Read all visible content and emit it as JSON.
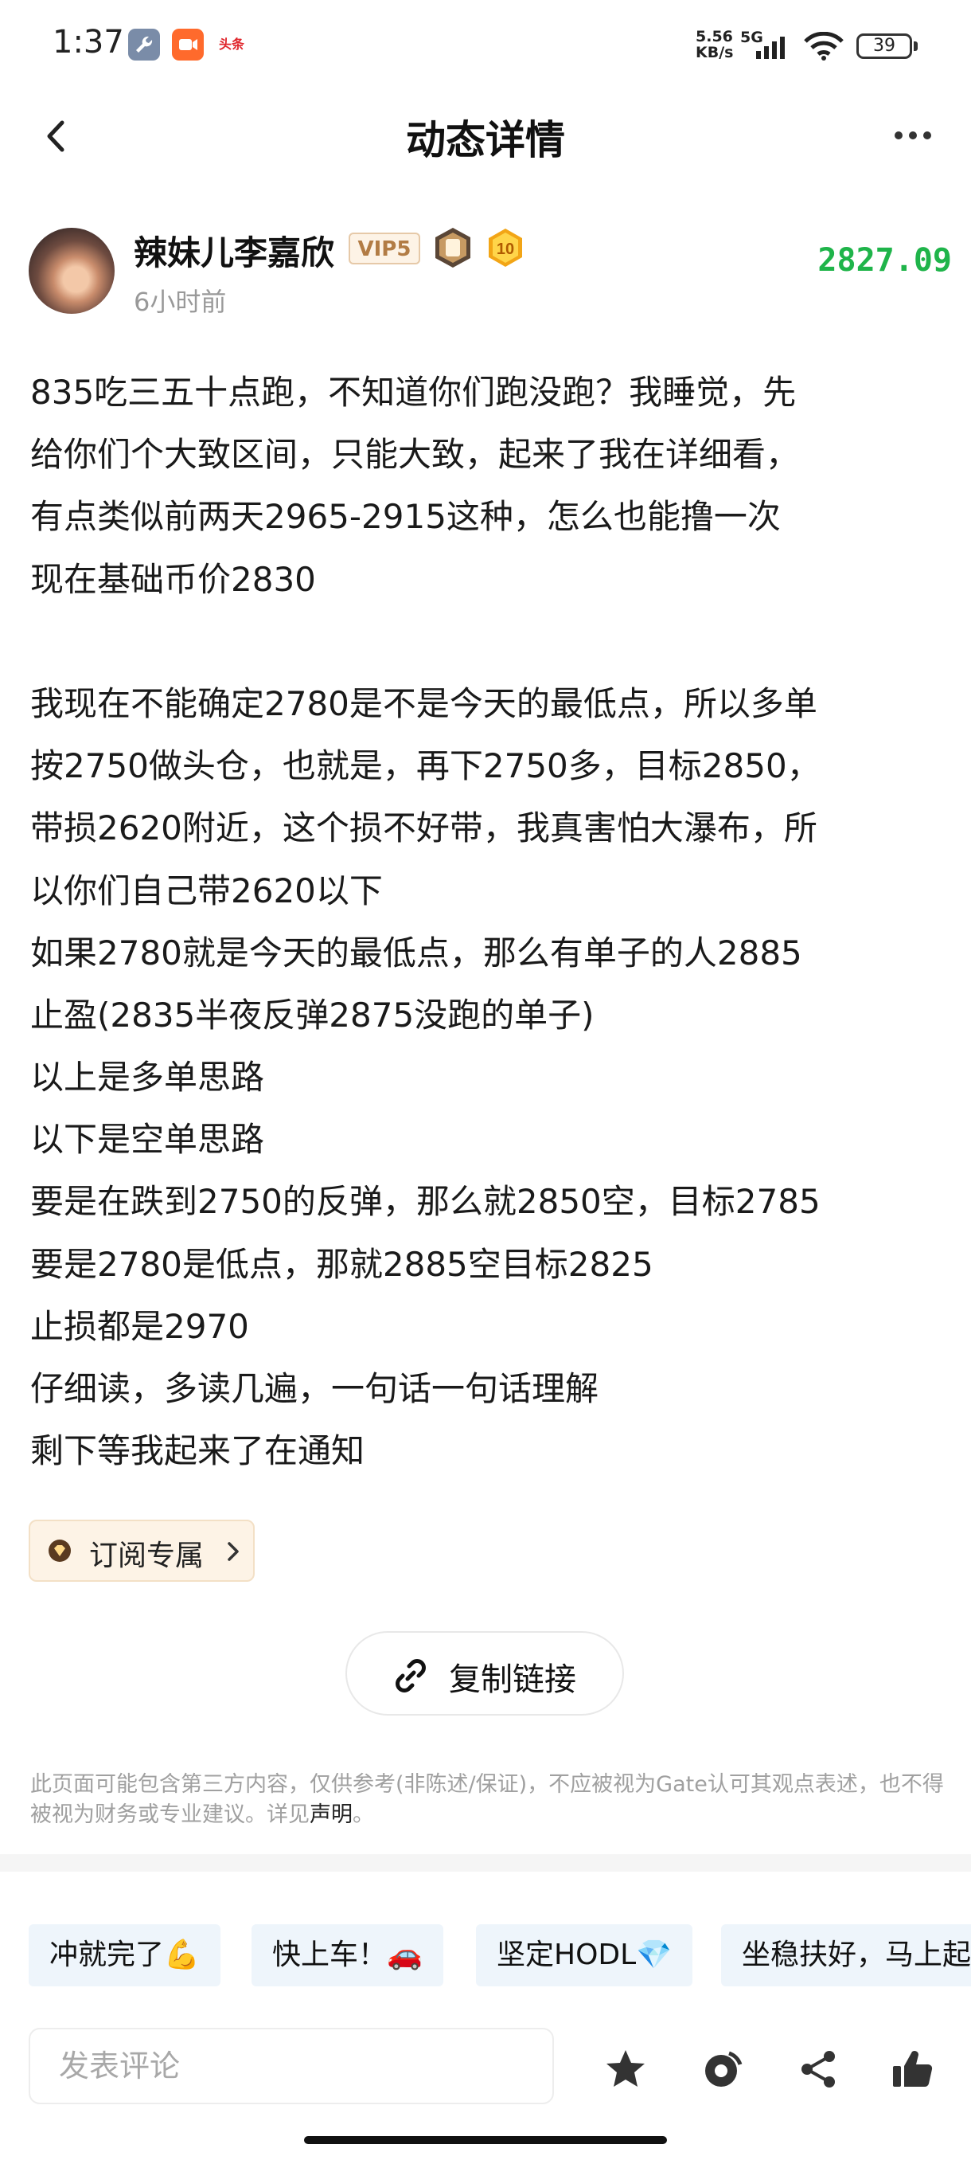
{
  "status_bar": {
    "time": "1:37",
    "news_label": "头条",
    "speed_top": "5.56",
    "speed_bottom": "KB/s",
    "network": "5G",
    "battery": "39"
  },
  "header": {
    "title": "动态详情"
  },
  "author": {
    "name": "辣妹儿李嘉欣",
    "vip": "VIP5",
    "level": "10",
    "time_ago": "6小时前",
    "value": "2827.09"
  },
  "post": {
    "lines": [
      "835吃三五十点跑，不知道你们跑没跑？我睡觉，先",
      "给你们个大致区间，只能大致，起来了我在详细看，",
      "有点类似前两天2965-2915这种，怎么也能撸一次",
      "现在基础币价2830",
      "",
      "我现在不能确定2780是不是今天的最低点，所以多单",
      "按2750做头仓，也就是，再下2750多，目标2850，",
      "带损2620附近，这个损不好带，我真害怕大瀑布，所",
      "以你们自己带2620以下",
      "如果2780就是今天的最低点，那么有单子的人2885",
      "止盈(2835半夜反弹2875没跑的单子)",
      "以上是多单思路",
      "以下是空单思路",
      "要是在跌到2750的反弹，那么就2850空，目标2785",
      "要是2780是低点，那就2885空目标2825",
      "止损都是2970",
      "仔细读，多读几遍，一句话一句话理解",
      "剩下等我起来了在通知"
    ]
  },
  "subscription": {
    "label": "订阅专属"
  },
  "copy_link": {
    "label": "复制链接"
  },
  "disclaimer": {
    "text": "此页面可能包含第三方内容，仅供参考(非陈述/保证)，不应被视为Gate认可其观点表述，也不得被视为财务或专业建议。详见",
    "link": "声明",
    "tail": "。"
  },
  "quick_replies": [
    "冲就完了💪",
    "快上车！🚗",
    "坚定HODL💎",
    "坐稳扶好，马上起飞"
  ],
  "comment_bar": {
    "placeholder": "发表评论",
    "icons": [
      "star-icon",
      "repost-icon",
      "share-icon",
      "like-icon"
    ]
  },
  "colors": {
    "price_green": "#1fb44a",
    "vip_gold": "#b27c45",
    "quick_bg": "#eef5fb"
  }
}
